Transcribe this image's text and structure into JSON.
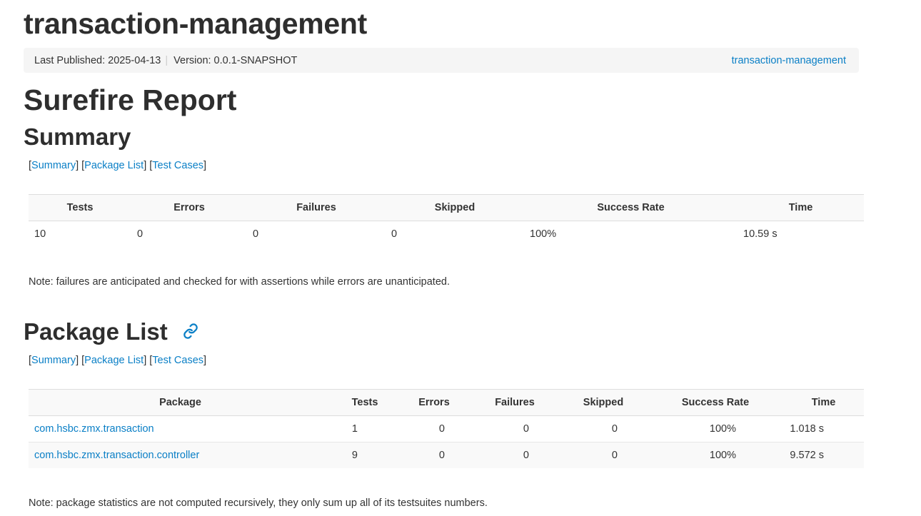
{
  "header": {
    "title": "transaction-management",
    "last_published": "Last Published: 2025-04-13",
    "separator": "|",
    "version": "Version: 0.0.1-SNAPSHOT",
    "project_link": "transaction-management"
  },
  "report_title": "Surefire Report",
  "nav": {
    "open": "[",
    "close": "]",
    "summary": "Summary",
    "package_list": "Package List",
    "test_cases": "Test Cases"
  },
  "summary": {
    "heading": "Summary",
    "columns": [
      "Tests",
      "Errors",
      "Failures",
      "Skipped",
      "Success Rate",
      "Time"
    ],
    "row": [
      "10",
      "0",
      "0",
      "0",
      "100%",
      "10.59 s"
    ],
    "note": "Note: failures are anticipated and checked for with assertions while errors are unanticipated."
  },
  "packages": {
    "heading": "Package List",
    "anchor_icon": "link-icon",
    "columns": [
      "Package",
      "Tests",
      "Errors",
      "Failures",
      "Skipped",
      "Success Rate",
      "Time"
    ],
    "rows": [
      [
        "com.hsbc.zmx.transaction",
        "1",
        "0",
        "0",
        "0",
        "100%",
        "1.018 s"
      ],
      [
        "com.hsbc.zmx.transaction.controller",
        "9",
        "0",
        "0",
        "0",
        "100%",
        "9.572 s"
      ]
    ],
    "note": "Note: package statistics are not computed recursively, they only sum up all of its testsuites numbers."
  },
  "colors": {
    "link": "#0a7fc6",
    "text": "#333333",
    "band": "#f5f5f5"
  }
}
